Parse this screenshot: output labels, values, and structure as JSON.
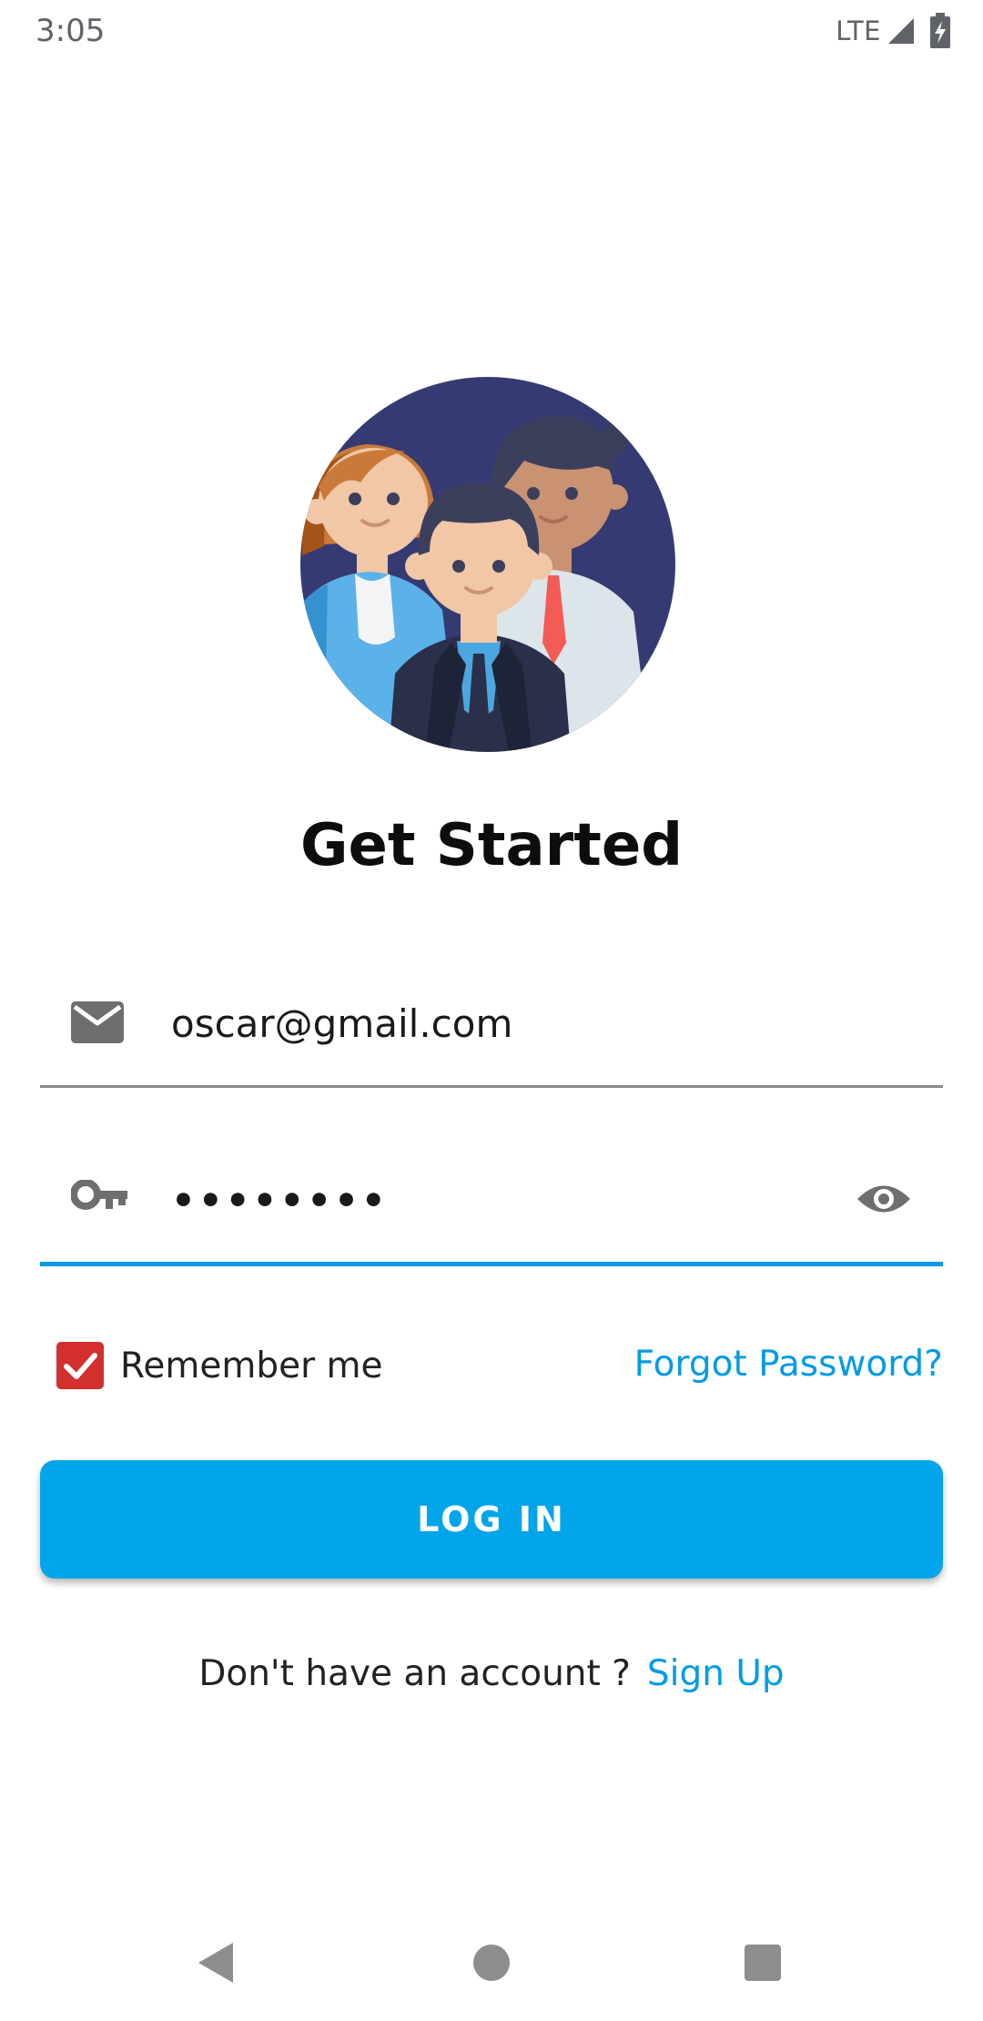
{
  "status_bar": {
    "time": "3:05",
    "network": "LTE",
    "icons": [
      "signal-icon",
      "battery-charging-icon"
    ]
  },
  "hero": {
    "icon": "team-illustration",
    "title": "Get Started"
  },
  "email_field": {
    "icon": "mail-icon",
    "value": "oscar@gmail.com"
  },
  "password_field": {
    "icon": "key-icon",
    "value": "••••••••",
    "toggle_icon": "eye-icon"
  },
  "remember": {
    "checked": true,
    "label": "Remember me"
  },
  "forgot_label": "Forgot Password?",
  "login_label": "LOG IN",
  "signup": {
    "prompt": "Don't have an account ?",
    "link": "Sign Up"
  },
  "nav": {
    "icons": [
      "back-icon",
      "home-icon",
      "recents-icon"
    ]
  },
  "colors": {
    "accent": "#039be5",
    "checkbox": "#d32f2f",
    "hero_circle": "#353b72"
  }
}
